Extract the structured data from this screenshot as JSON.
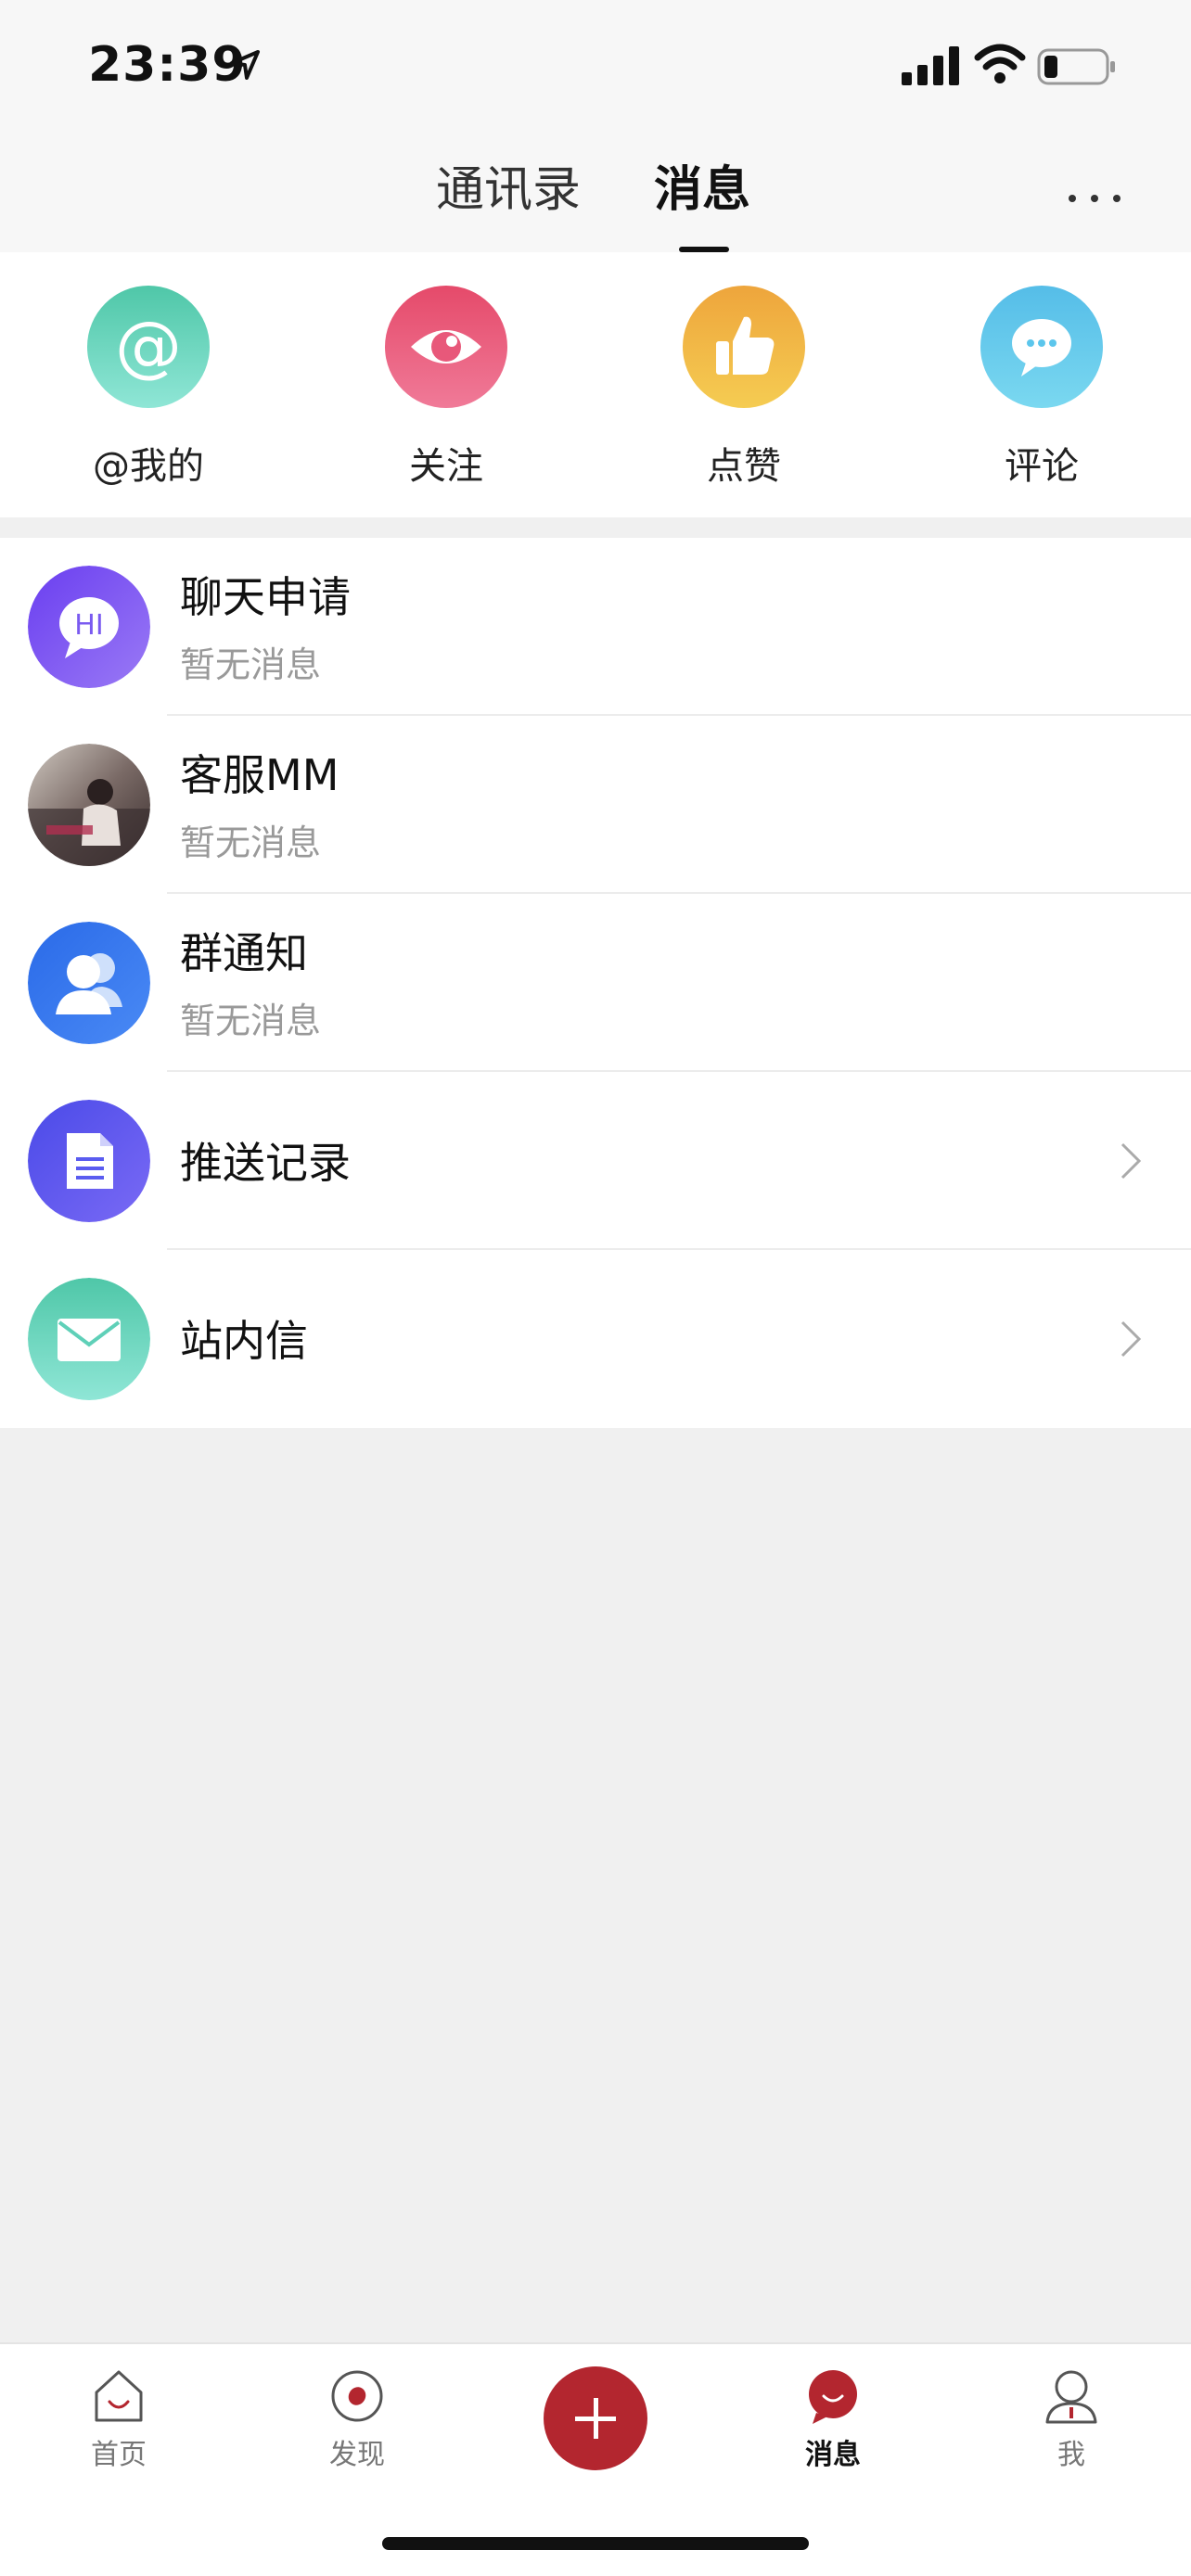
{
  "status_bar": {
    "time": "23:39",
    "icons": [
      "location-arrow-icon",
      "signal-icon",
      "wifi-icon",
      "battery-icon"
    ]
  },
  "header": {
    "tabs": [
      {
        "label": "通讯录",
        "active": false
      },
      {
        "label": "消息",
        "active": true
      }
    ],
    "more_icon": "more-icon"
  },
  "quick_actions": [
    {
      "label": "@我的",
      "icon": "at-icon",
      "color": "#5fd0b8"
    },
    {
      "label": "关注",
      "icon": "eye-icon",
      "color": "#e8587a"
    },
    {
      "label": "点赞",
      "icon": "thumbs-up-icon",
      "color": "#f0b040"
    },
    {
      "label": "评论",
      "icon": "comment-icon",
      "color": "#5cc6ec"
    }
  ],
  "messages": [
    {
      "title": "聊天申请",
      "subtitle": "暂无消息",
      "icon": "chat-hi-icon",
      "color": "#7a5af0"
    },
    {
      "title": "客服MM",
      "subtitle": "暂无消息",
      "icon": "avatar-photo",
      "color": "#6a5a5a"
    },
    {
      "title": "群通知",
      "subtitle": "暂无消息",
      "icon": "group-icon",
      "color": "#3a7cf0"
    },
    {
      "title": "推送记录",
      "subtitle": "",
      "icon": "document-icon",
      "color": "#5a5cf0",
      "chevron": true
    },
    {
      "title": "站内信",
      "subtitle": "",
      "icon": "mail-icon",
      "color": "#5fd0b8",
      "chevron": true
    }
  ],
  "bottom_nav": {
    "items": [
      {
        "label": "首页",
        "icon": "home-icon",
        "active": false
      },
      {
        "label": "发现",
        "icon": "discover-icon",
        "active": false
      },
      {
        "label": "",
        "icon": "plus-icon",
        "active": false
      },
      {
        "label": "消息",
        "icon": "message-icon",
        "active": true
      },
      {
        "label": "我",
        "icon": "profile-icon",
        "active": false
      }
    ],
    "accent": "#b3262f"
  }
}
